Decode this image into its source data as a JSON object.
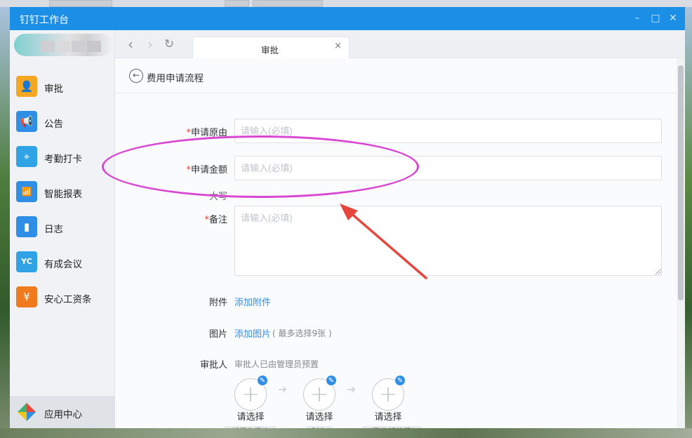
{
  "window": {
    "title": "钉钉工作台"
  },
  "sidebar": {
    "items": [
      {
        "label": "审批",
        "icon": "person-stamp-icon",
        "color": "#f5a623",
        "glyph": "👤"
      },
      {
        "label": "公告",
        "icon": "megaphone-icon",
        "color": "#2f8ee6",
        "glyph": "📢"
      },
      {
        "label": "考勤打卡",
        "icon": "location-pin-icon",
        "color": "#2fa3e6",
        "glyph": "⌖"
      },
      {
        "label": "智能报表",
        "icon": "bar-chart-icon",
        "color": "#2f8ee6",
        "glyph": "📶"
      },
      {
        "label": "日志",
        "icon": "notebook-icon",
        "color": "#2f8ee6",
        "glyph": "▮"
      },
      {
        "label": "有成会议",
        "icon": "meeting-icon",
        "color": "#2fa3e6",
        "glyph": "YC"
      },
      {
        "label": "安心工资条",
        "icon": "payslip-icon",
        "color": "#f07a1e",
        "glyph": "¥"
      }
    ],
    "app_center": {
      "label": "应用中心",
      "icon": "app-center-icon"
    }
  },
  "browser": {
    "tab_label": "审批",
    "close_glyph": "×"
  },
  "page": {
    "back_icon": "back-arrow-icon",
    "title": "费用申请流程"
  },
  "form": {
    "required_mark": "*",
    "reason": {
      "label": "申请原由",
      "placeholder": "请输入(必填)"
    },
    "amount": {
      "label": "申请金额",
      "placeholder": "请输入(必填)"
    },
    "uppercase": {
      "label": "大写"
    },
    "remark": {
      "label": "备注",
      "placeholder": "请输入(必填)"
    },
    "attachment": {
      "label": "附件",
      "link": "添加附件"
    },
    "image": {
      "label": "图片",
      "link": "添加图片",
      "hint": "( 最多选择9张 )"
    },
    "approver": {
      "label": "审批人",
      "note": "审批人已由管理员预置",
      "nodes": [
        {
          "label": "请选择",
          "role": "部门负责人"
        },
        {
          "label": "请选择",
          "role": "财务"
        },
        {
          "label": "请选择",
          "role": "事业部总经"
        }
      ]
    }
  },
  "colors": {
    "titlebar": "#1b8fe6",
    "link": "#2f8ee6",
    "required": "#e0473a",
    "annotation": "#d946d2",
    "arrow": "#e8453c"
  }
}
